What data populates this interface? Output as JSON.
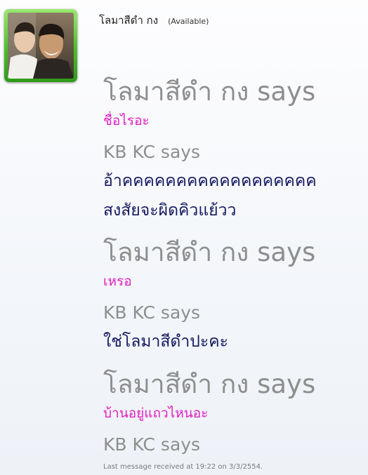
{
  "contact": {
    "name": "โลมาสีดำ กง",
    "status": "(Available)"
  },
  "conversation": [
    {
      "says": "โลมาสีดำ กง says",
      "lines": [
        "ชื่อไรอะ"
      ]
    },
    {
      "says": "KB KC says",
      "lines": [
        "อ้าคคคคคคคคคคคคคคคคคค",
        "สงสัยจะผิดคิวแย้วว"
      ]
    },
    {
      "says": "โลมาสีดำ กง says",
      "lines": [
        "เหรอ"
      ]
    },
    {
      "says": "KB KC says",
      "lines": [
        "ใช่โลมาสีดำปะคะ"
      ]
    },
    {
      "says": "โลมาสีดำ กง says",
      "lines": [
        "บ้านอยู่แถวไหนอะ"
      ]
    },
    {
      "says": "KB KC says",
      "lines": []
    }
  ],
  "footer": "Last message received at 19:22 on 3/3/2554.",
  "colors": {
    "contact_text": "#e21fc0",
    "self_text": "#15195f",
    "says_text": "#8e8e8e",
    "frame_green": "#4bbf2c"
  }
}
